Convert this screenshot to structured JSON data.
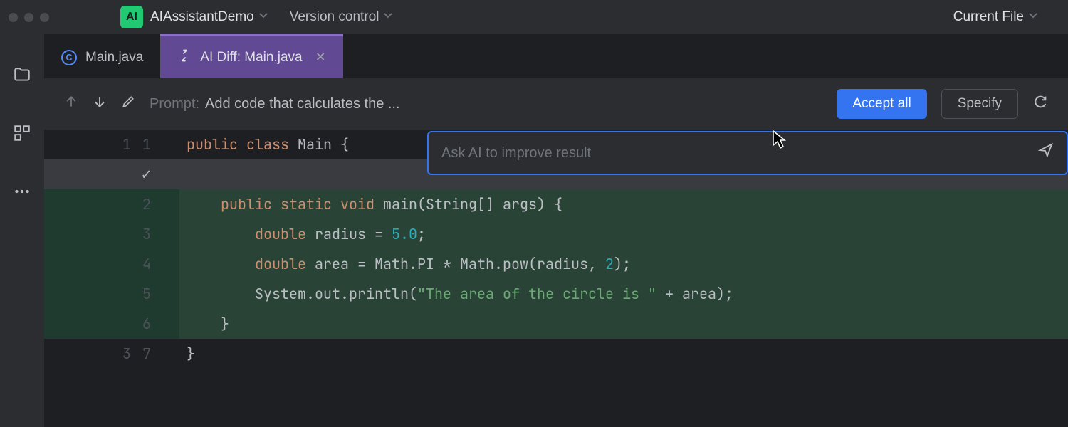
{
  "titlebar": {
    "ai_badge": "AI",
    "project_name": "AIAssistantDemo",
    "version_control": "Version control",
    "current_file": "Current File"
  },
  "tabs": [
    {
      "icon_letter": "C",
      "label": "Main.java",
      "active": false
    },
    {
      "label": "AI Diff: Main.java",
      "active": true
    }
  ],
  "toolbar": {
    "prompt_label": "Prompt:",
    "prompt_text": "Add code that calculates the ...",
    "accept_label": "Accept all",
    "specify_label": "Specify"
  },
  "ask_popup": {
    "placeholder": "Ask AI to improve result"
  },
  "code": {
    "lines": [
      {
        "left": "1",
        "right": "1",
        "class": "",
        "tokens": [
          [
            "kw",
            "public"
          ],
          [
            "",
            " "
          ],
          [
            "kw",
            "class"
          ],
          [
            "",
            " "
          ],
          [
            "cls",
            "Main"
          ],
          [
            "",
            " {"
          ]
        ]
      },
      {
        "left": "",
        "right": "",
        "class": "check-row",
        "check": true,
        "tokens": []
      },
      {
        "left": "",
        "right": "2",
        "class": "added",
        "tokens": [
          [
            "",
            "    "
          ],
          [
            "kw",
            "public"
          ],
          [
            "",
            " "
          ],
          [
            "kw",
            "static"
          ],
          [
            "",
            " "
          ],
          [
            "type",
            "void"
          ],
          [
            "",
            " "
          ],
          [
            "mtd",
            "main"
          ],
          [
            "",
            "("
          ],
          [
            "cls",
            "String"
          ],
          [
            "",
            "[] args) {"
          ]
        ]
      },
      {
        "left": "",
        "right": "3",
        "class": "added",
        "tokens": [
          [
            "",
            "        "
          ],
          [
            "type",
            "double"
          ],
          [
            "",
            " radius = "
          ],
          [
            "num",
            "5.0"
          ],
          [
            "",
            ";"
          ]
        ]
      },
      {
        "left": "",
        "right": "4",
        "class": "added",
        "tokens": [
          [
            "",
            "        "
          ],
          [
            "type",
            "double"
          ],
          [
            "",
            " area = Math.PI * Math.pow(radius, "
          ],
          [
            "num",
            "2"
          ],
          [
            "",
            ");"
          ]
        ]
      },
      {
        "left": "",
        "right": "5",
        "class": "added",
        "tokens": [
          [
            "",
            "        System.out.println("
          ],
          [
            "str",
            "\"The area of the circle is \""
          ],
          [
            "",
            " + area);"
          ]
        ]
      },
      {
        "left": "",
        "right": "6",
        "class": "added",
        "tokens": [
          [
            "",
            "    }"
          ]
        ]
      },
      {
        "left": "3",
        "right": "7",
        "class": "",
        "tokens": [
          [
            "",
            "}"
          ]
        ]
      }
    ]
  }
}
